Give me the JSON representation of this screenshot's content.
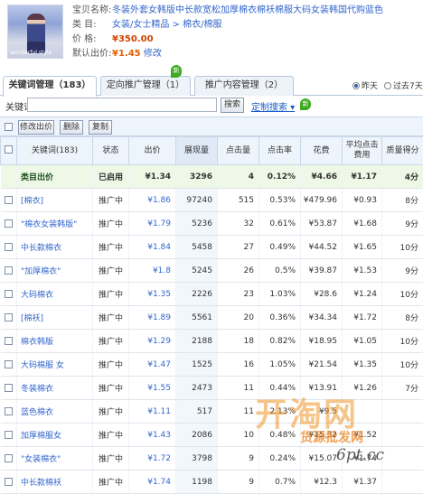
{
  "product": {
    "name_label": "宝贝名称:",
    "name": "冬装外套女韩版中长款宽松加厚棉衣棉袄棉服大码女装韩国代购蓝色",
    "category_label": "类    目:",
    "category": "女装/女士精品 > 棉衣/棉服",
    "price_label": "价    格:",
    "price": "¥350.00",
    "default_bid_label": "默认出价:",
    "default_bid": "¥1.45",
    "edit_link": "修改",
    "thumb_text": "wonderful style"
  },
  "tabs": [
    {
      "label": "关键词管理（183）"
    },
    {
      "label": "定向推广管理（1）"
    },
    {
      "label": "推广内容管理（2）"
    }
  ],
  "new_badge": "新",
  "date_options": [
    {
      "label": "昨天",
      "selected": true
    },
    {
      "label": "过去7天",
      "selected": false
    }
  ],
  "search": {
    "label": "关键词:",
    "value": "",
    "button": "搜索",
    "custom": "定制搜索 ▾",
    "new_badge": "新"
  },
  "toolbar": {
    "modify_bid": "修改出价",
    "delete": "删除",
    "copy": "复制"
  },
  "table": {
    "headers": [
      "关键词(183)",
      "状态",
      "出价",
      "展现量",
      "点击量",
      "点击率",
      "花费",
      "平均点击费用",
      "质量得分"
    ],
    "summary": {
      "keyword": "类目出价",
      "status": "已启用",
      "bid": "¥1.34",
      "impressions": "3296",
      "clicks": "4",
      "ctr": "0.12%",
      "cost": "¥4.66",
      "avg_cpc": "¥1.17",
      "quality": "4分"
    },
    "rows": [
      {
        "keyword": "[棉衣]",
        "status": "推广中",
        "bid": "¥1.86",
        "impressions": "97240",
        "clicks": "515",
        "ctr": "0.53%",
        "cost": "¥479.96",
        "avg_cpc": "¥0.93",
        "quality": "8分"
      },
      {
        "keyword": "\"棉衣女装韩版\"",
        "status": "推广中",
        "bid": "¥1.79",
        "impressions": "5236",
        "clicks": "32",
        "ctr": "0.61%",
        "cost": "¥53.87",
        "avg_cpc": "¥1.68",
        "quality": "9分"
      },
      {
        "keyword": "中长款棉衣",
        "status": "推广中",
        "bid": "¥1.84",
        "impressions": "5458",
        "clicks": "27",
        "ctr": "0.49%",
        "cost": "¥44.52",
        "avg_cpc": "¥1.65",
        "quality": "10分"
      },
      {
        "keyword": "\"加厚棉衣\"",
        "status": "推广中",
        "bid": "¥1.8",
        "impressions": "5245",
        "clicks": "26",
        "ctr": "0.5%",
        "cost": "¥39.87",
        "avg_cpc": "¥1.53",
        "quality": "9分"
      },
      {
        "keyword": "大码棉衣",
        "status": "推广中",
        "bid": "¥1.35",
        "impressions": "2226",
        "clicks": "23",
        "ctr": "1.03%",
        "cost": "¥28.6",
        "avg_cpc": "¥1.24",
        "quality": "10分"
      },
      {
        "keyword": "[棉袄]",
        "status": "推广中",
        "bid": "¥1.89",
        "impressions": "5561",
        "clicks": "20",
        "ctr": "0.36%",
        "cost": "¥34.34",
        "avg_cpc": "¥1.72",
        "quality": "8分"
      },
      {
        "keyword": "棉衣韩版",
        "status": "推广中",
        "bid": "¥1.29",
        "impressions": "2188",
        "clicks": "18",
        "ctr": "0.82%",
        "cost": "¥18.95",
        "avg_cpc": "¥1.05",
        "quality": "10分"
      },
      {
        "keyword": "大码棉服 女",
        "status": "推广中",
        "bid": "¥1.47",
        "impressions": "1525",
        "clicks": "16",
        "ctr": "1.05%",
        "cost": "¥21.54",
        "avg_cpc": "¥1.35",
        "quality": "10分"
      },
      {
        "keyword": "冬装棉衣",
        "status": "推广中",
        "bid": "¥1.55",
        "impressions": "2473",
        "clicks": "11",
        "ctr": "0.44%",
        "cost": "¥13.91",
        "avg_cpc": "¥1.26",
        "quality": "7分"
      },
      {
        "keyword": "蓝色棉衣",
        "status": "推广中",
        "bid": "¥1.11",
        "impressions": "517",
        "clicks": "11",
        "ctr": "2.13%",
        "cost": "¥9.5",
        "avg_cpc": "",
        "quality": ""
      },
      {
        "keyword": "加厚棉服女",
        "status": "推广中",
        "bid": "¥1.43",
        "impressions": "2086",
        "clicks": "10",
        "ctr": "0.48%",
        "cost": "¥15.32",
        "avg_cpc": "¥1.52",
        "quality": ""
      },
      {
        "keyword": "\"女装棉衣\"",
        "status": "推广中",
        "bid": "¥1.72",
        "impressions": "3798",
        "clicks": "9",
        "ctr": "0.24%",
        "cost": "¥15.07",
        "avg_cpc": "¥1.74",
        "quality": ""
      },
      {
        "keyword": "中长款棉袄",
        "status": "推广中",
        "bid": "¥1.74",
        "impressions": "1198",
        "clicks": "9",
        "ctr": "0.7%",
        "cost": "¥12.3",
        "avg_cpc": "¥1.37",
        "quality": ""
      }
    ]
  },
  "watermark": {
    "logo": "开淘网",
    "slogan": "货源批发网",
    "site": "6pt.cc"
  }
}
